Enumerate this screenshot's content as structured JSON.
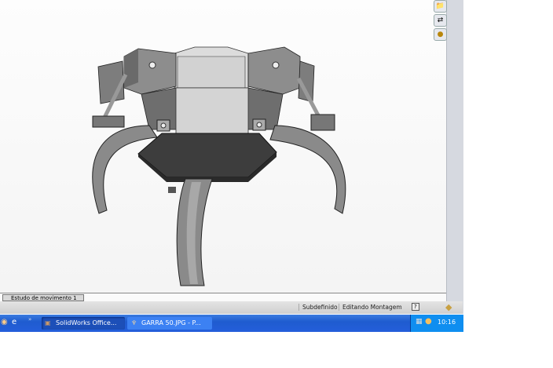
{
  "tabs": {
    "motion_study": "Estudo de movimento 1"
  },
  "status": {
    "definition": "Subdefinido",
    "mode": "Editando Montagem",
    "help": "?"
  },
  "taskbar": {
    "items": [
      {
        "label": "SolidWorks Office..."
      },
      {
        "label": "GARRA 50.JPG - P..."
      }
    ],
    "quicklaunch_more": "»",
    "clock": "10:16"
  },
  "colors": {
    "taskbar": "#245edb",
    "tray": "#0f8ef0"
  }
}
